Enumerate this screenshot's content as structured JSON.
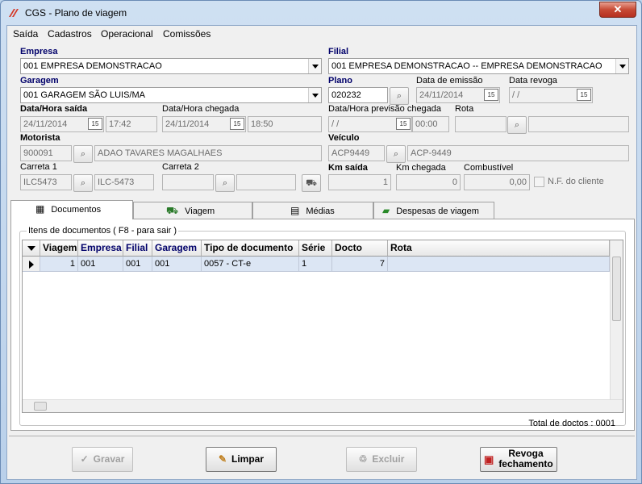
{
  "window": {
    "title": "CGS - Plano de viagem",
    "close_label": "✕"
  },
  "menu": [
    {
      "label": "Saída"
    },
    {
      "label": "Cadastros"
    },
    {
      "label": "Operacional"
    },
    {
      "label": "Comissões"
    }
  ],
  "form": {
    "empresa_label": "Empresa",
    "empresa_value": "001 EMPRESA DEMONSTRACAO",
    "filial_label": "Filial",
    "filial_value": "001 EMPRESA DEMONSTRACAO -- EMPRESA DEMONSTRACAO",
    "garagem_label": "Garagem",
    "garagem_value": "001 GARAGEM SÃO LUIS/MA",
    "plano_label": "Plano",
    "plano_value": "020232",
    "data_emissao_label": "Data de emissão",
    "data_emissao_value": "24/11/2014",
    "data_revoga_label": "Data revoga",
    "data_revoga_value": " /  /",
    "saida_label": "Data/Hora saída",
    "saida_date": "24/11/2014",
    "saida_time": "17:42",
    "chegada_label": "Data/Hora chegada",
    "chegada_date": "24/11/2014",
    "chegada_time": "18:50",
    "previsao_label": "Data/Hora previsão chegada",
    "previsao_date": " /  /",
    "previsao_time": "00:00",
    "rota_label": "Rota",
    "rota_code": "",
    "rota_name": "",
    "motorista_label": "Motorista",
    "motorista_code": "900091",
    "motorista_name": "ADAO TAVARES MAGALHAES",
    "veiculo_label": "Veículo",
    "veiculo_code": "ACP9449",
    "veiculo_name": "ACP-9449",
    "carreta1_label": "Carreta 1",
    "carreta1_code": "ILC5473",
    "carreta1_name": "ILC-5473",
    "carreta2_label": "Carreta 2",
    "carreta2_code": "",
    "carreta2_name": "",
    "km_saida_label": "Km saída",
    "km_saida_value": "1",
    "km_chegada_label": "Km chegada",
    "km_chegada_value": "0",
    "combustivel_label": "Combustível",
    "combustivel_value": "0,00",
    "nf_label": "N.F. do cliente",
    "cal_icon_text": "15"
  },
  "tabs": [
    {
      "label": "Documentos",
      "icon": "building-icon"
    },
    {
      "label": "Viagem",
      "icon": "truck-icon"
    },
    {
      "label": "Médias",
      "icon": "calculator-icon"
    },
    {
      "label": "Despesas de viagem",
      "icon": "money-icon"
    }
  ],
  "documents": {
    "group_title": "Itens de documentos ( F8 - para sair )",
    "columns": [
      "Viagem",
      "Empresa",
      "Filial",
      "Garagem",
      "Tipo de documento",
      "Série",
      "Docto",
      "Rota"
    ],
    "rows": [
      [
        "1",
        "001",
        "001",
        "001",
        "0057 - CT-e",
        "1",
        "7",
        ""
      ]
    ],
    "total": "Total de doctos : 0001"
  },
  "buttons": {
    "gravar": "Gravar",
    "limpar": "Limpar",
    "excluir": "Excluir",
    "revoga_line1": "Revoga",
    "revoga_line2": "fechamento"
  }
}
